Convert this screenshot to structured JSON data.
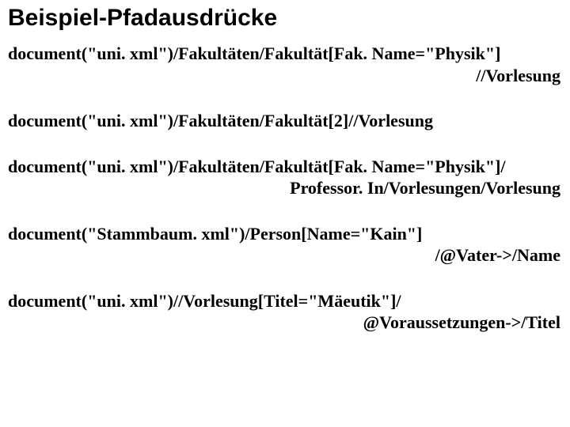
{
  "title": "Beispiel-Pfadausdrücke",
  "expressions": [
    {
      "line1": "document(\"uni. xml\")/Fakultäten/Fakultät[Fak. Name=\"Physik\"]",
      "line2": "//Vorlesung"
    },
    {
      "line1": "document(\"uni. xml\")/Fakultäten/Fakultät[2]//Vorlesung",
      "line2": ""
    },
    {
      "line1": "document(\"uni. xml\")/Fakultäten/Fakultät[Fak. Name=\"Physik\"]/",
      "line2": "Professor. In/Vorlesungen/Vorlesung"
    },
    {
      "line1": "document(\"Stammbaum. xml\")/Person[Name=\"Kain\"]",
      "line2": "/@Vater->/Name"
    },
    {
      "line1": "document(\"uni. xml\")//Vorlesung[Titel=\"Mäeutik\"]/",
      "line2": "@Voraussetzungen->/Titel"
    }
  ]
}
